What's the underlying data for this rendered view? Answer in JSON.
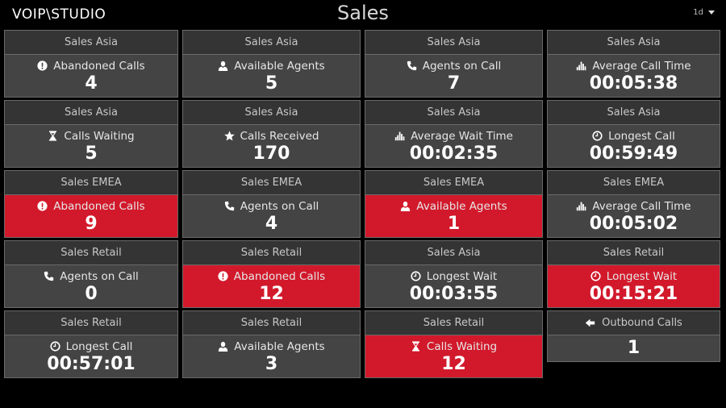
{
  "header": {
    "logo": "VOIP\\STUDIO",
    "title": "Sales",
    "period": "1d"
  },
  "colors": {
    "background": "#000000",
    "tile_header": "#343434",
    "tile_body": "#444444",
    "alert": "#d2192b",
    "border": "#6a6a6a"
  },
  "tiles": [
    {
      "group": "Sales Asia",
      "icon": "exclamation-circle-icon",
      "label": "Abandoned Calls",
      "value": "4",
      "alert": false
    },
    {
      "group": "Sales Asia",
      "icon": "user-icon",
      "label": "Available Agents",
      "value": "5",
      "alert": false
    },
    {
      "group": "Sales Asia",
      "icon": "phone-icon",
      "label": "Agents on Call",
      "value": "7",
      "alert": false
    },
    {
      "group": "Sales Asia",
      "icon": "bar-chart-icon",
      "label": "Average Call Time",
      "value": "00:05:38",
      "alert": false
    },
    {
      "group": "Sales Asia",
      "icon": "hourglass-icon",
      "label": "Calls Waiting",
      "value": "5",
      "alert": false
    },
    {
      "group": "Sales Asia",
      "icon": "star-icon",
      "label": "Calls Received",
      "value": "170",
      "alert": false
    },
    {
      "group": "Sales Asia",
      "icon": "bar-chart-icon",
      "label": "Average Wait Time",
      "value": "00:02:35",
      "alert": false
    },
    {
      "group": "Sales Asia",
      "icon": "clock-icon",
      "label": "Longest Call",
      "value": "00:59:49",
      "alert": false
    },
    {
      "group": "Sales EMEA",
      "icon": "exclamation-circle-icon",
      "label": "Abandoned Calls",
      "value": "9",
      "alert": true
    },
    {
      "group": "Sales EMEA",
      "icon": "phone-icon",
      "label": "Agents on Call",
      "value": "4",
      "alert": false
    },
    {
      "group": "Sales EMEA",
      "icon": "user-icon",
      "label": "Available Agents",
      "value": "1",
      "alert": true
    },
    {
      "group": "Sales EMEA",
      "icon": "bar-chart-icon",
      "label": "Average Call Time",
      "value": "00:05:02",
      "alert": false
    },
    {
      "group": "Sales Retail",
      "icon": "phone-icon",
      "label": "Agents on Call",
      "value": "0",
      "alert": false
    },
    {
      "group": "Sales Retail",
      "icon": "exclamation-circle-icon",
      "label": "Abandoned Calls",
      "value": "12",
      "alert": true
    },
    {
      "group": "Sales Asia",
      "icon": "clock-icon",
      "label": "Longest Wait",
      "value": "00:03:55",
      "alert": false
    },
    {
      "group": "Sales Retail",
      "icon": "clock-icon",
      "label": "Longest Wait",
      "value": "00:15:21",
      "alert": true
    },
    {
      "group": "Sales Retail",
      "icon": "clock-icon",
      "label": "Longest Call",
      "value": "00:57:01",
      "alert": false
    },
    {
      "group": "Sales Retail",
      "icon": "user-icon",
      "label": "Available Agents",
      "value": "3",
      "alert": false
    },
    {
      "group": "Sales Retail",
      "icon": "hourglass-icon",
      "label": "Calls Waiting",
      "value": "12",
      "alert": true
    }
  ],
  "outbound": {
    "icon": "arrow-left-icon",
    "label": "Outbound Calls",
    "value": "1"
  }
}
